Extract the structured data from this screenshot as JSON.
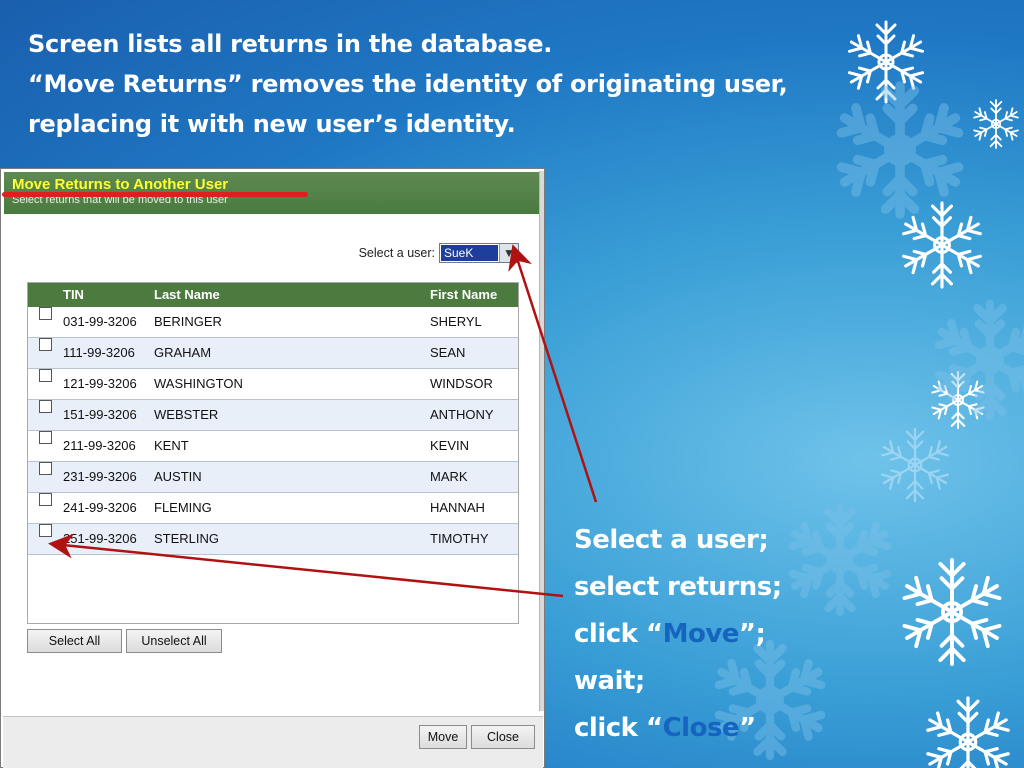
{
  "heading": {
    "line1": "Screen lists all returns in the database.",
    "line2": "“Move Returns” removes the identity of originating user,",
    "line3": "replacing it with new user’s identity."
  },
  "dialog": {
    "title": "Move Returns to Another User",
    "subtitle": "Select returns that will be moved to this user",
    "select_user_label": "Select a user:",
    "selected_user": "SueK",
    "columns": {
      "tin": "TIN",
      "last": "Last Name",
      "first": "First Name"
    },
    "rows": [
      {
        "tin": "031-99-3206",
        "last": "BERINGER",
        "first": "SHERYL"
      },
      {
        "tin": "111-99-3206",
        "last": "GRAHAM",
        "first": "SEAN"
      },
      {
        "tin": "121-99-3206",
        "last": "WASHINGTON",
        "first": "WINDSOR"
      },
      {
        "tin": "151-99-3206",
        "last": "WEBSTER",
        "first": "ANTHONY"
      },
      {
        "tin": "211-99-3206",
        "last": "KENT",
        "first": "KEVIN"
      },
      {
        "tin": "231-99-3206",
        "last": "AUSTIN",
        "first": "MARK"
      },
      {
        "tin": "241-99-3206",
        "last": "FLEMING",
        "first": "HANNAH"
      },
      {
        "tin": "251-99-3206",
        "last": "STERLING",
        "first": "TIMOTHY"
      }
    ],
    "select_all": "Select All",
    "unselect_all": "Unselect All",
    "move": "Move",
    "close": "Close"
  },
  "instructions": {
    "line1": "Select a user;",
    "line2": "select returns;",
    "line3_prefix": "click “",
    "line3_highlight": "Move",
    "line3_suffix": "”;",
    "line4": "wait;",
    "line5_prefix": "click “",
    "line5_highlight": "Close",
    "line5_suffix": "”"
  },
  "colors": {
    "header_green": "#4d7a3f",
    "title_yellow": "#ffff33",
    "highlight_blue": "#1565c0",
    "annotation_red": "#b01212"
  }
}
